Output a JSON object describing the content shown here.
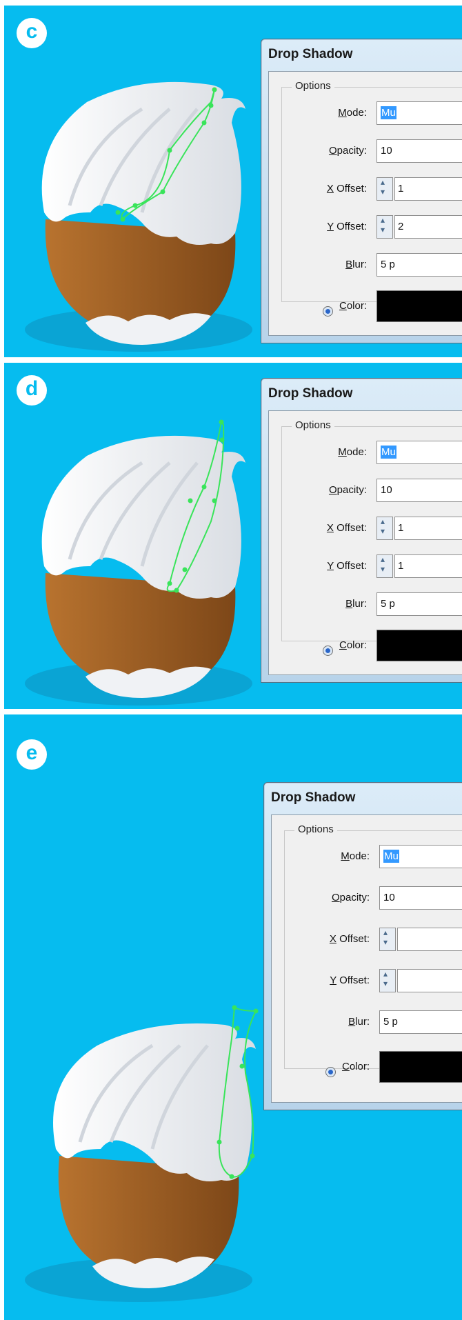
{
  "panels": [
    {
      "step": "c",
      "dialog": {
        "title": "Drop Shadow",
        "group_label": "Options",
        "mode": {
          "label_pre": "",
          "label_key": "M",
          "label_post": "ode:",
          "value": "Mu"
        },
        "opacity": {
          "label_key": "O",
          "label_post": "pacity:",
          "value": "10"
        },
        "x_offset": {
          "label_key": "X",
          "label_post": " Offset:",
          "value": "1"
        },
        "y_offset": {
          "label_key": "Y",
          "label_post": " Offset:",
          "value": "2"
        },
        "blur": {
          "label_pre": "",
          "label_key": "B",
          "label_post": "lur:",
          "value": "5 p"
        },
        "color": {
          "label_key": "C",
          "label_post": "olor:",
          "swatch": "#000000"
        }
      }
    },
    {
      "step": "d",
      "dialog": {
        "title": "Drop Shadow",
        "group_label": "Options",
        "mode": {
          "label_key": "M",
          "label_post": "ode:",
          "value": "Mu"
        },
        "opacity": {
          "label_key": "O",
          "label_post": "pacity:",
          "value": "10"
        },
        "x_offset": {
          "label_key": "X",
          "label_post": " Offset:",
          "value": "1"
        },
        "y_offset": {
          "label_key": "Y",
          "label_post": " Offset:",
          "value": "1"
        },
        "blur": {
          "label_key": "B",
          "label_post": "lur:",
          "value": "5 p"
        },
        "color": {
          "label_key": "C",
          "label_post": "olor:",
          "swatch": "#000000"
        }
      }
    },
    {
      "step": "e",
      "dialog": {
        "title": "Drop Shadow",
        "group_label": "Options",
        "mode": {
          "label_key": "M",
          "label_post": "ode:",
          "value": "Mu"
        },
        "opacity": {
          "label_key": "O",
          "label_post": "pacity:",
          "value": "10"
        },
        "x_offset": {
          "label_key": "X",
          "label_post": " Offset:",
          "value": ""
        },
        "y_offset": {
          "label_key": "Y",
          "label_post": " Offset:",
          "value": ""
        },
        "blur": {
          "label_key": "B",
          "label_post": "lur:",
          "value": "5 p"
        },
        "color": {
          "label_key": "C",
          "label_post": "olor:",
          "swatch": "#000000"
        }
      }
    }
  ],
  "colors": {
    "background": "#06bcef",
    "cream": "#f2f3f5",
    "chocolate": "#9a5b26",
    "path_highlight": "#39e45a"
  }
}
